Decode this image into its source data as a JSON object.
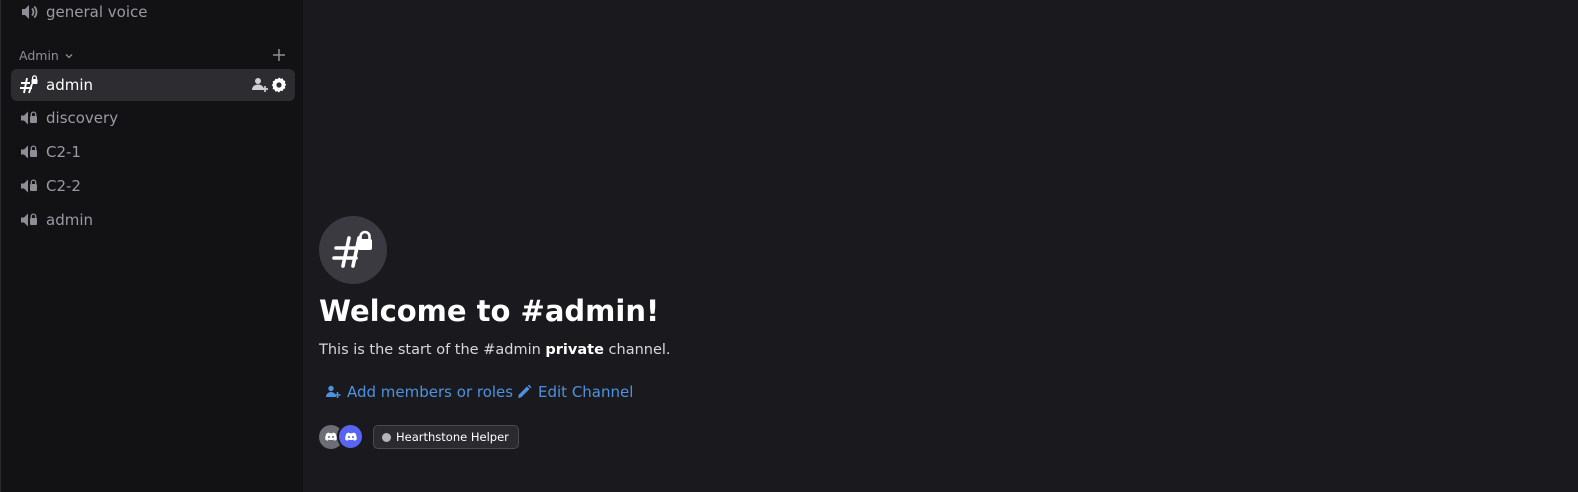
{
  "sidebar": {
    "top_channel": {
      "label": "general voice",
      "icon": "speaker-icon"
    },
    "category": {
      "label": "Admin",
      "icon": "chevron-down-icon",
      "add_icon": "plus-icon"
    },
    "channels": [
      {
        "label": "admin",
        "type": "text-locked",
        "active": true
      },
      {
        "label": "discovery",
        "type": "voice-locked"
      },
      {
        "label": "C2-1",
        "type": "voice-locked"
      },
      {
        "label": "C2-2",
        "type": "voice-locked"
      },
      {
        "label": "admin",
        "type": "voice-locked"
      }
    ]
  },
  "welcome": {
    "title": "Welcome to #admin!",
    "desc_prefix": "This is the start of the #admin ",
    "desc_bold": "private",
    "desc_suffix": " channel.",
    "add_members_label": "Add members or roles",
    "edit_channel_label": "Edit Channel",
    "member_pill_label": "Hearthstone Helper"
  },
  "colors": {
    "accent_link": "#4e91e0",
    "bot_avatar": "#5865f2",
    "sidebar_bg": "#121214",
    "main_bg": "#1a1a1e"
  }
}
